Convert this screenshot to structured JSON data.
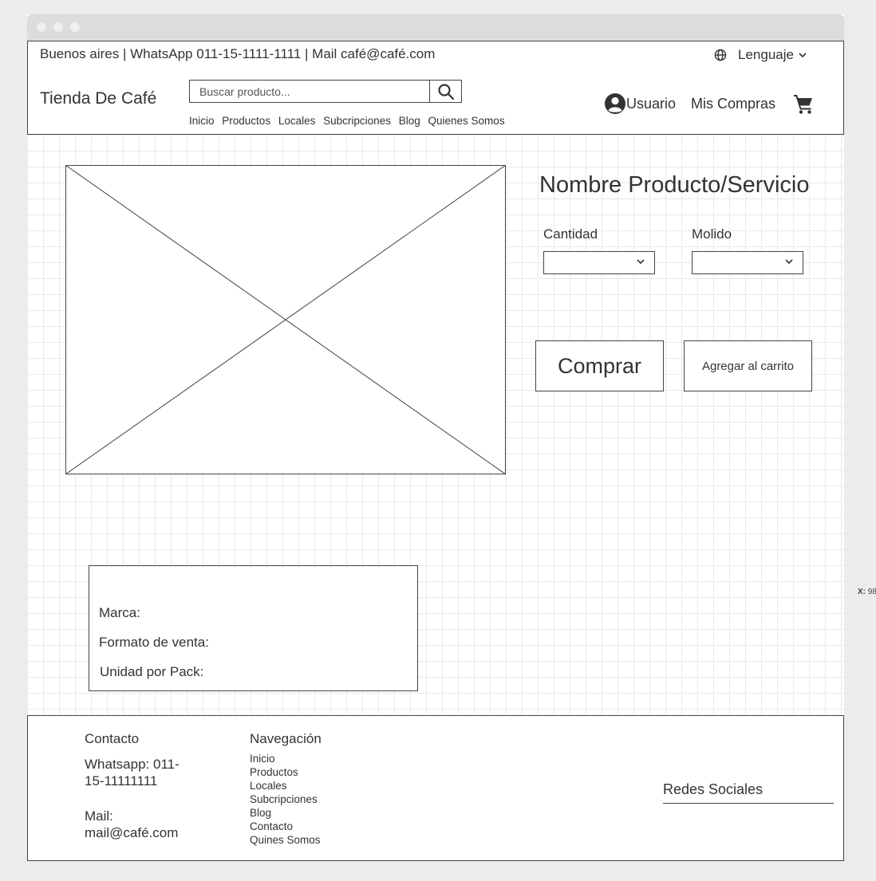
{
  "topbar": {
    "contact_line": "Buenos aires | WhatsApp 011-15-1111-1111 | Mail café@café.com",
    "language_label": "Lenguaje"
  },
  "header": {
    "brand": "Tienda De Café",
    "search_placeholder": "Buscar producto...",
    "nav": [
      "Inicio",
      "Productos",
      "Locales",
      "Subcripciones",
      "Blog",
      "Quienes Somos"
    ],
    "user_label": "Usuario",
    "purchases_label": "Mis Compras"
  },
  "product": {
    "name": "Nombre Producto/Servicio",
    "quantity_label": "Cantidad",
    "grind_label": "Molido",
    "quantity_value": "",
    "grind_value": "",
    "buy_label": "Comprar",
    "add_to_cart_label": "Agregar al carrito",
    "specs": {
      "brand": "Marca:",
      "format": "Formato de venta:",
      "units": "Unidad por Pack:"
    }
  },
  "footer": {
    "contact_title": "Contacto",
    "whatsapp_line1": "Whatsapp: 011-",
    "whatsapp_line2": "15-11111111",
    "mail_line1": "Mail:",
    "mail_line2": "mail@café.com",
    "nav_title": "Navegación",
    "nav_items": [
      "Inicio",
      "Productos",
      "Locales",
      "Subcripciones",
      "Blog",
      "Contacto",
      "Quines Somos"
    ],
    "social_title": "Redes Sociales"
  },
  "cursor_readout": {
    "label": "X:",
    "value": "98"
  }
}
